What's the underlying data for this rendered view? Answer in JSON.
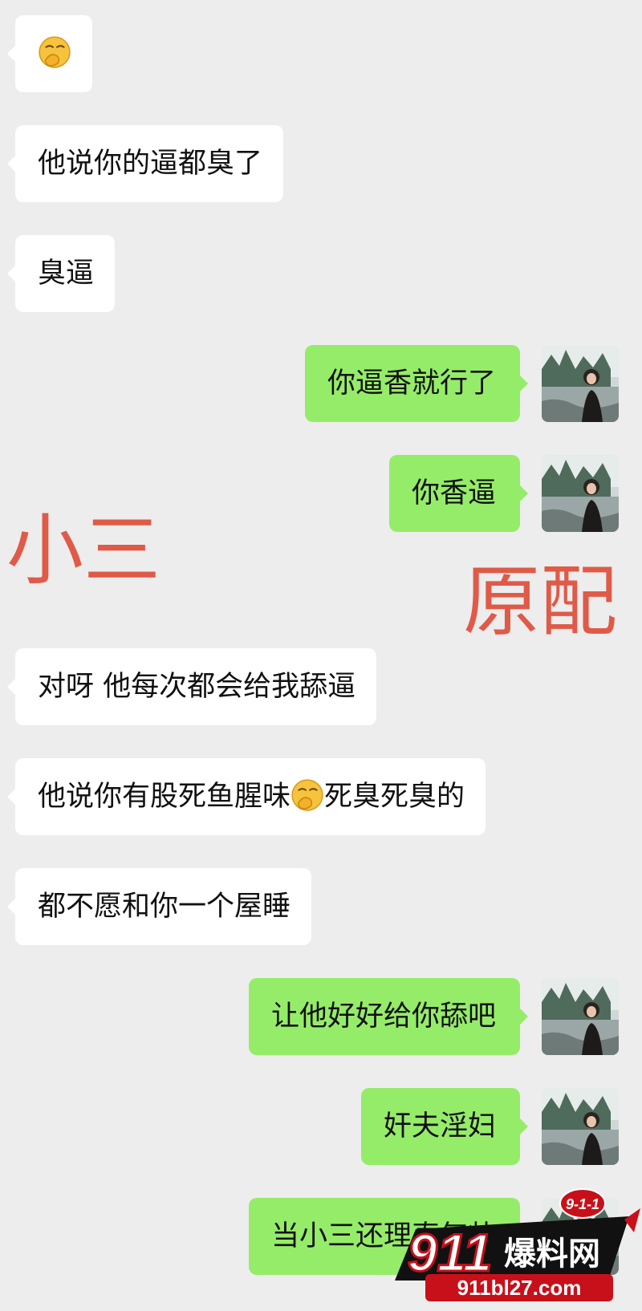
{
  "messages": [
    {
      "side": "in",
      "text": ""
    },
    {
      "side": "in",
      "text": "他说你的逼都臭了"
    },
    {
      "side": "in",
      "text": "臭逼"
    },
    {
      "side": "out",
      "text": "你逼香就行了"
    },
    {
      "side": "out",
      "text": "你香逼"
    },
    {
      "side": "in",
      "text": "对呀 他每次都会给我舔逼"
    },
    {
      "side": "in",
      "text_before": "他说你有股死鱼腥味",
      "text_after": "死臭死臭的"
    },
    {
      "side": "in",
      "text": "都不愿和你一个屋睡"
    },
    {
      "side": "out",
      "text": "让他好好给你舔吧"
    },
    {
      "side": "out",
      "text": "奸夫淫妇"
    },
    {
      "side": "out",
      "text": "当小三还理直气壮"
    }
  ],
  "annotations": {
    "left_label": "小三",
    "right_label": "原配"
  },
  "icons": {
    "emoji": "thinking-face-hand-over-mouth",
    "avatar": "landscape-portrait-avatar"
  },
  "watermark": {
    "badge": "9-1-1",
    "brand_number": "911",
    "brand_name": "爆料网",
    "url": "911bl27.com"
  },
  "colors": {
    "background": "#ededed",
    "incoming_bubble": "#ffffff",
    "outgoing_bubble": "#95ec69",
    "label_red": "#e05a48"
  }
}
